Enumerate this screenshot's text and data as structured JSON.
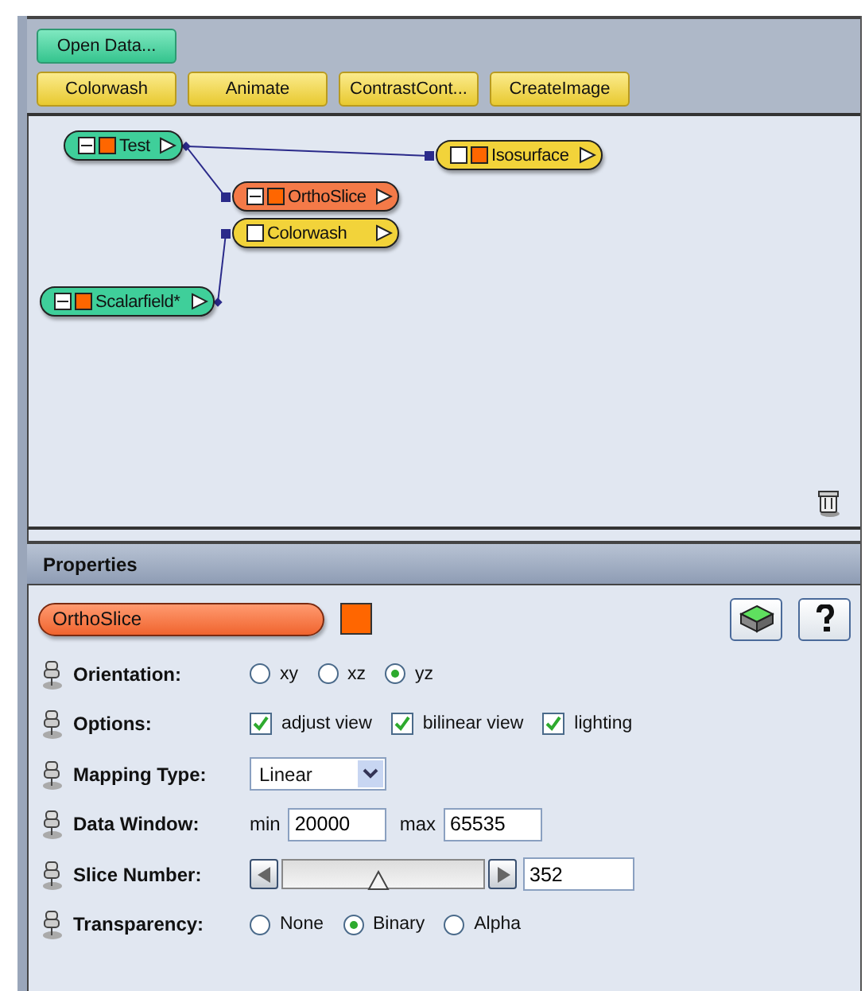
{
  "toolbar": {
    "primary_button": "Open Data...",
    "module_buttons": [
      "Colorwash",
      "Animate",
      "ContrastCont...",
      "CreateImage"
    ]
  },
  "network": {
    "nodes": [
      {
        "label": "Test",
        "color": "#3fcf9a",
        "minus": true,
        "port_square": true
      },
      {
        "label": "Isosurface",
        "color": "#f2d33a",
        "minus": false,
        "port_square": true
      },
      {
        "label": "OrthoSlice",
        "color": "#f47a48",
        "minus": true,
        "port_square": true
      },
      {
        "label": "Colorwash",
        "color": "#f2d33a",
        "minus": false,
        "port_square": false
      },
      {
        "label": "Scalarfield*",
        "color": "#3fcf9a",
        "minus": true,
        "port_square": true
      }
    ]
  },
  "properties": {
    "title": "Properties",
    "module": {
      "name": "OrthoSlice",
      "color": "#ff6600"
    },
    "rows": [
      {
        "kind": "radio",
        "label": "Orientation:",
        "options": [
          {
            "label": "xy",
            "selected": false
          },
          {
            "label": "xz",
            "selected": false
          },
          {
            "label": "yz",
            "selected": true
          }
        ]
      },
      {
        "kind": "checkbox",
        "label": "Options:",
        "options": [
          {
            "label": "adjust view",
            "checked": true
          },
          {
            "label": "bilinear view",
            "checked": true
          },
          {
            "label": "lighting",
            "checked": true
          }
        ]
      },
      {
        "kind": "dropdown",
        "label": "Mapping Type:",
        "value": "Linear"
      },
      {
        "kind": "range",
        "label": "Data Window:",
        "min_label": "min",
        "min_value": "20000",
        "max_label": "max",
        "max_value": "65535"
      },
      {
        "kind": "slider",
        "label": "Slice Number:",
        "level": 0.48,
        "value": "352"
      },
      {
        "kind": "radio",
        "label": "Transparency:",
        "options": [
          {
            "label": "None",
            "selected": false
          },
          {
            "label": "Binary",
            "selected": true
          },
          {
            "label": "Alpha",
            "selected": false
          }
        ]
      }
    ]
  }
}
